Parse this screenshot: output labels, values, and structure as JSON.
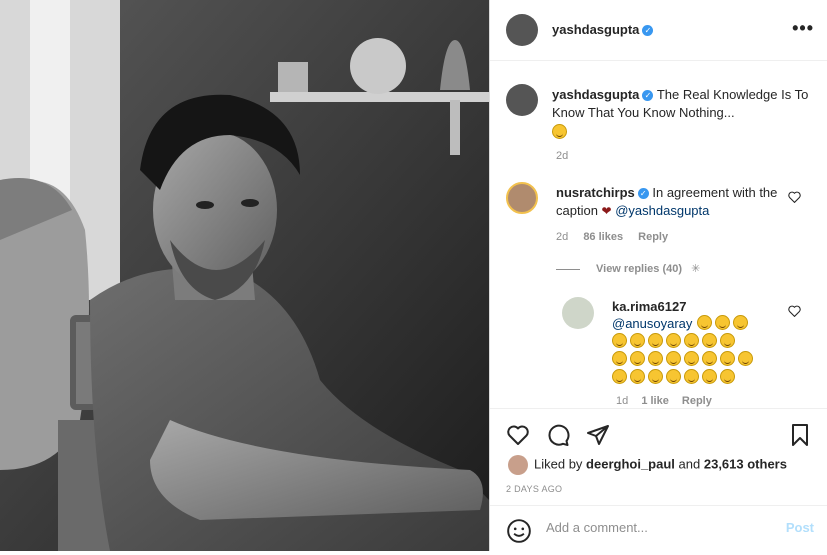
{
  "header": {
    "username": "yashdasgupta",
    "more_label": "•••"
  },
  "caption": {
    "username": "yashdasgupta",
    "text": "The Real Knowledge Is To Know That You Know Nothing...",
    "time": "2d"
  },
  "comments": [
    {
      "username": "nusratchirps",
      "text": "In agreement with the caption",
      "mention": "@yashdasgupta",
      "time": "2d",
      "likes": "86 likes",
      "reply": "Reply",
      "view_replies": "View replies (40)"
    },
    {
      "username": "ka.rima6127",
      "mention": "@anusoyaray",
      "emoji_count": 21,
      "time": "1d",
      "likes": "1 like",
      "reply": "Reply"
    }
  ],
  "likes": {
    "prefix": "Liked by",
    "user": "deerghoi_paul",
    "conj": "and",
    "others": "23,613 others"
  },
  "date_ago": "2 DAYS AGO",
  "add_comment": {
    "placeholder": "Add a comment...",
    "post_label": "Post"
  },
  "colors": {
    "verified": "#3897f0",
    "mention": "#00376b",
    "post_disabled": "#b2dffc",
    "muted": "#8e8e8e"
  }
}
